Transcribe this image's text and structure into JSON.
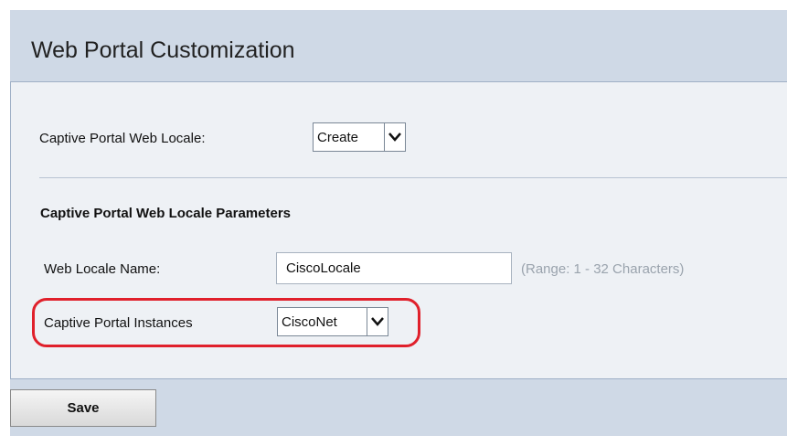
{
  "page": {
    "title": "Web Portal Customization"
  },
  "locale_selector": {
    "label": "Captive Portal Web Locale:",
    "value": "Create"
  },
  "parameters": {
    "heading": "Captive Portal Web Locale Parameters",
    "web_locale_name": {
      "label": "Web Locale Name:",
      "value": "CiscoLocale",
      "hint": "(Range: 1 - 32 Characters)"
    },
    "instances": {
      "label": "Captive Portal Instances",
      "value": "CiscoNet"
    }
  },
  "actions": {
    "save_label": "Save"
  },
  "colors": {
    "highlight": "#e0202b",
    "background": "#cfd9e6",
    "panel": "#eef1f5"
  },
  "icons": {
    "dropdown": "chevron-down-icon"
  }
}
